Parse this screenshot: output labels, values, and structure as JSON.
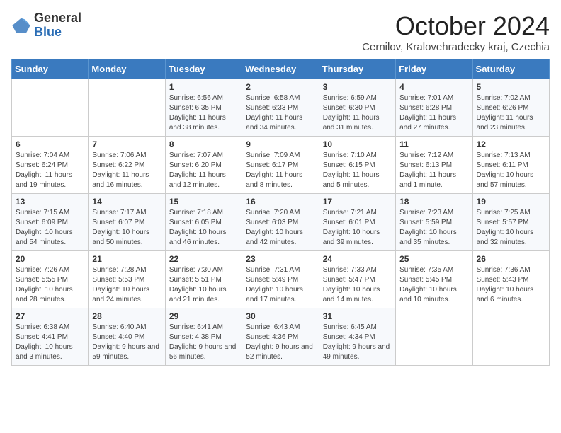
{
  "header": {
    "logo_general": "General",
    "logo_blue": "Blue",
    "month_title": "October 2024",
    "subtitle": "Cernilov, Kralovehradecky kraj, Czechia"
  },
  "days_of_week": [
    "Sunday",
    "Monday",
    "Tuesday",
    "Wednesday",
    "Thursday",
    "Friday",
    "Saturday"
  ],
  "weeks": [
    [
      {
        "day": "",
        "info": ""
      },
      {
        "day": "",
        "info": ""
      },
      {
        "day": "1",
        "info": "Sunrise: 6:56 AM\nSunset: 6:35 PM\nDaylight: 11 hours and 38 minutes."
      },
      {
        "day": "2",
        "info": "Sunrise: 6:58 AM\nSunset: 6:33 PM\nDaylight: 11 hours and 34 minutes."
      },
      {
        "day": "3",
        "info": "Sunrise: 6:59 AM\nSunset: 6:30 PM\nDaylight: 11 hours and 31 minutes."
      },
      {
        "day": "4",
        "info": "Sunrise: 7:01 AM\nSunset: 6:28 PM\nDaylight: 11 hours and 27 minutes."
      },
      {
        "day": "5",
        "info": "Sunrise: 7:02 AM\nSunset: 6:26 PM\nDaylight: 11 hours and 23 minutes."
      }
    ],
    [
      {
        "day": "6",
        "info": "Sunrise: 7:04 AM\nSunset: 6:24 PM\nDaylight: 11 hours and 19 minutes."
      },
      {
        "day": "7",
        "info": "Sunrise: 7:06 AM\nSunset: 6:22 PM\nDaylight: 11 hours and 16 minutes."
      },
      {
        "day": "8",
        "info": "Sunrise: 7:07 AM\nSunset: 6:20 PM\nDaylight: 11 hours and 12 minutes."
      },
      {
        "day": "9",
        "info": "Sunrise: 7:09 AM\nSunset: 6:17 PM\nDaylight: 11 hours and 8 minutes."
      },
      {
        "day": "10",
        "info": "Sunrise: 7:10 AM\nSunset: 6:15 PM\nDaylight: 11 hours and 5 minutes."
      },
      {
        "day": "11",
        "info": "Sunrise: 7:12 AM\nSunset: 6:13 PM\nDaylight: 11 hours and 1 minute."
      },
      {
        "day": "12",
        "info": "Sunrise: 7:13 AM\nSunset: 6:11 PM\nDaylight: 10 hours and 57 minutes."
      }
    ],
    [
      {
        "day": "13",
        "info": "Sunrise: 7:15 AM\nSunset: 6:09 PM\nDaylight: 10 hours and 54 minutes."
      },
      {
        "day": "14",
        "info": "Sunrise: 7:17 AM\nSunset: 6:07 PM\nDaylight: 10 hours and 50 minutes."
      },
      {
        "day": "15",
        "info": "Sunrise: 7:18 AM\nSunset: 6:05 PM\nDaylight: 10 hours and 46 minutes."
      },
      {
        "day": "16",
        "info": "Sunrise: 7:20 AM\nSunset: 6:03 PM\nDaylight: 10 hours and 42 minutes."
      },
      {
        "day": "17",
        "info": "Sunrise: 7:21 AM\nSunset: 6:01 PM\nDaylight: 10 hours and 39 minutes."
      },
      {
        "day": "18",
        "info": "Sunrise: 7:23 AM\nSunset: 5:59 PM\nDaylight: 10 hours and 35 minutes."
      },
      {
        "day": "19",
        "info": "Sunrise: 7:25 AM\nSunset: 5:57 PM\nDaylight: 10 hours and 32 minutes."
      }
    ],
    [
      {
        "day": "20",
        "info": "Sunrise: 7:26 AM\nSunset: 5:55 PM\nDaylight: 10 hours and 28 minutes."
      },
      {
        "day": "21",
        "info": "Sunrise: 7:28 AM\nSunset: 5:53 PM\nDaylight: 10 hours and 24 minutes."
      },
      {
        "day": "22",
        "info": "Sunrise: 7:30 AM\nSunset: 5:51 PM\nDaylight: 10 hours and 21 minutes."
      },
      {
        "day": "23",
        "info": "Sunrise: 7:31 AM\nSunset: 5:49 PM\nDaylight: 10 hours and 17 minutes."
      },
      {
        "day": "24",
        "info": "Sunrise: 7:33 AM\nSunset: 5:47 PM\nDaylight: 10 hours and 14 minutes."
      },
      {
        "day": "25",
        "info": "Sunrise: 7:35 AM\nSunset: 5:45 PM\nDaylight: 10 hours and 10 minutes."
      },
      {
        "day": "26",
        "info": "Sunrise: 7:36 AM\nSunset: 5:43 PM\nDaylight: 10 hours and 6 minutes."
      }
    ],
    [
      {
        "day": "27",
        "info": "Sunrise: 6:38 AM\nSunset: 4:41 PM\nDaylight: 10 hours and 3 minutes."
      },
      {
        "day": "28",
        "info": "Sunrise: 6:40 AM\nSunset: 4:40 PM\nDaylight: 9 hours and 59 minutes."
      },
      {
        "day": "29",
        "info": "Sunrise: 6:41 AM\nSunset: 4:38 PM\nDaylight: 9 hours and 56 minutes."
      },
      {
        "day": "30",
        "info": "Sunrise: 6:43 AM\nSunset: 4:36 PM\nDaylight: 9 hours and 52 minutes."
      },
      {
        "day": "31",
        "info": "Sunrise: 6:45 AM\nSunset: 4:34 PM\nDaylight: 9 hours and 49 minutes."
      },
      {
        "day": "",
        "info": ""
      },
      {
        "day": "",
        "info": ""
      }
    ]
  ]
}
